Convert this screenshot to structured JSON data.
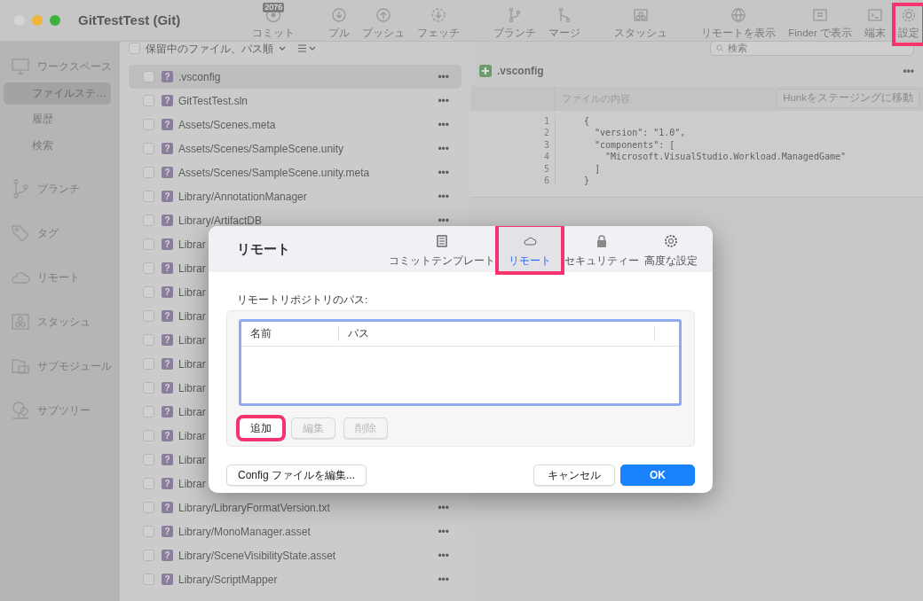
{
  "window": {
    "title": "GitTestTest (Git)"
  },
  "toolbar": [
    {
      "items": [
        {
          "label": "コミット",
          "badge": "2076",
          "highlighted": false
        }
      ]
    },
    {
      "items": [
        {
          "label": "プル",
          "highlighted": false
        },
        {
          "label": "プッシュ",
          "highlighted": false
        },
        {
          "label": "フェッチ",
          "highlighted": false
        }
      ]
    },
    {
      "items": [
        {
          "label": "ブランチ",
          "highlighted": false
        },
        {
          "label": "マージ",
          "highlighted": false
        }
      ]
    },
    {
      "items": [
        {
          "label": "スタッシュ",
          "highlighted": false
        }
      ]
    },
    {
      "items": [
        {
          "label": "リモートを表示",
          "highlighted": false
        },
        {
          "label": "Finder で表示",
          "highlighted": false
        },
        {
          "label": "端末",
          "highlighted": false
        },
        {
          "label": "設定",
          "highlighted": true
        }
      ]
    }
  ],
  "sidebar": {
    "sections": [
      {
        "label": "ワークスペース",
        "children": [
          {
            "label": "ファイルステ…",
            "selected": true
          },
          {
            "label": "履歴",
            "selected": false
          },
          {
            "label": "検索",
            "selected": false
          }
        ]
      },
      {
        "label": "ブランチ"
      },
      {
        "label": "タグ"
      },
      {
        "label": "リモート"
      },
      {
        "label": "スタッシュ"
      },
      {
        "label": "サブモジュール"
      },
      {
        "label": "サブツリー"
      }
    ]
  },
  "file_list": {
    "select_all_checked": false,
    "sort": "保留中のファイル、パス順",
    "search": {
      "placeholder": "検索"
    },
    "files": [
      {
        "status": "?",
        "name": ".vsconfig",
        "more": "•••",
        "selected": true,
        "checked": false
      },
      {
        "status": "?",
        "name": "GitTestTest.sln",
        "more": "•••",
        "selected": false,
        "checked": false
      },
      {
        "status": "?",
        "name": "Assets/Scenes.meta",
        "more": "•••",
        "selected": false,
        "checked": false
      },
      {
        "status": "?",
        "name": "Assets/Scenes/SampleScene.unity",
        "more": "•••",
        "selected": false,
        "checked": false
      },
      {
        "status": "?",
        "name": "Assets/Scenes/SampleScene.unity.meta",
        "more": "•••",
        "selected": false,
        "checked": false
      },
      {
        "status": "?",
        "name": "Library/AnnotationManager",
        "more": "•••",
        "selected": false,
        "checked": false
      },
      {
        "status": "?",
        "name": "Library/ArtifactDB",
        "more": "•••",
        "selected": false,
        "checked": false
      },
      {
        "status": "?",
        "name": "Librar",
        "selected": false,
        "checked": false
      },
      {
        "status": "?",
        "name": "Librar",
        "selected": false,
        "checked": false
      },
      {
        "status": "?",
        "name": "Librar",
        "selected": false,
        "checked": false
      },
      {
        "status": "?",
        "name": "Librar",
        "selected": false,
        "checked": false
      },
      {
        "status": "?",
        "name": "Librar",
        "selected": false,
        "checked": false
      },
      {
        "status": "?",
        "name": "Librar",
        "selected": false,
        "checked": false
      },
      {
        "status": "?",
        "name": "Librar",
        "selected": false,
        "checked": false
      },
      {
        "status": "?",
        "name": "Librar",
        "selected": false,
        "checked": false
      },
      {
        "status": "?",
        "name": "Librar",
        "selected": false,
        "checked": false
      },
      {
        "status": "?",
        "name": "Librar",
        "selected": false,
        "checked": false
      },
      {
        "status": "?",
        "name": "Librar",
        "selected": false,
        "checked": false
      },
      {
        "status": "?",
        "name": "Library/LibraryFormatVersion.txt",
        "more": "•••",
        "selected": false,
        "checked": false
      },
      {
        "status": "?",
        "name": "Library/MonoManager.asset",
        "more": "•••",
        "selected": false,
        "checked": false
      },
      {
        "status": "?",
        "name": "Library/SceneVisibilityState.asset",
        "more": "•••",
        "selected": false,
        "checked": false
      },
      {
        "status": "?",
        "name": "Library/ScriptMapper",
        "more": "•••",
        "selected": false,
        "checked": false
      }
    ]
  },
  "diff": {
    "file": ".vsconfig",
    "more": "•••",
    "heading": "ファイルの内容",
    "stage_button": "Hunkをステージングに移動",
    "lines": [
      {
        "number": "1",
        "text": "{"
      },
      {
        "number": "2",
        "text": "  \"version\": \"1.0\","
      },
      {
        "number": "3",
        "text": "  \"components\": ["
      },
      {
        "number": "4",
        "text": "    \"Microsoft.VisualStudio.Workload.ManagedGame\""
      },
      {
        "number": "5",
        "text": "  ]"
      },
      {
        "number": "6",
        "text": "}"
      }
    ]
  },
  "dialog": {
    "title": "リモート",
    "tabs": [
      {
        "label": "コミットテンプレート",
        "selected": false,
        "highlighted": false
      },
      {
        "label": "リモート",
        "selected": true,
        "highlighted": true
      },
      {
        "label": "セキュリティー",
        "selected": false,
        "highlighted": false
      },
      {
        "label": "高度な設定",
        "selected": false,
        "highlighted": false
      }
    ],
    "section_label": "リモートリポジトリのパス:",
    "table": {
      "columns": [
        "名前",
        "パス"
      ]
    },
    "buttons": [
      {
        "label": "追加",
        "disabled": false,
        "highlighted": true
      },
      {
        "label": "編集",
        "disabled": true,
        "highlighted": false
      },
      {
        "label": "削除",
        "disabled": true,
        "highlighted": false
      }
    ],
    "config_button": "Config ファイルを編集...",
    "cancel_button": "キャンセル",
    "ok_button": "OK"
  }
}
